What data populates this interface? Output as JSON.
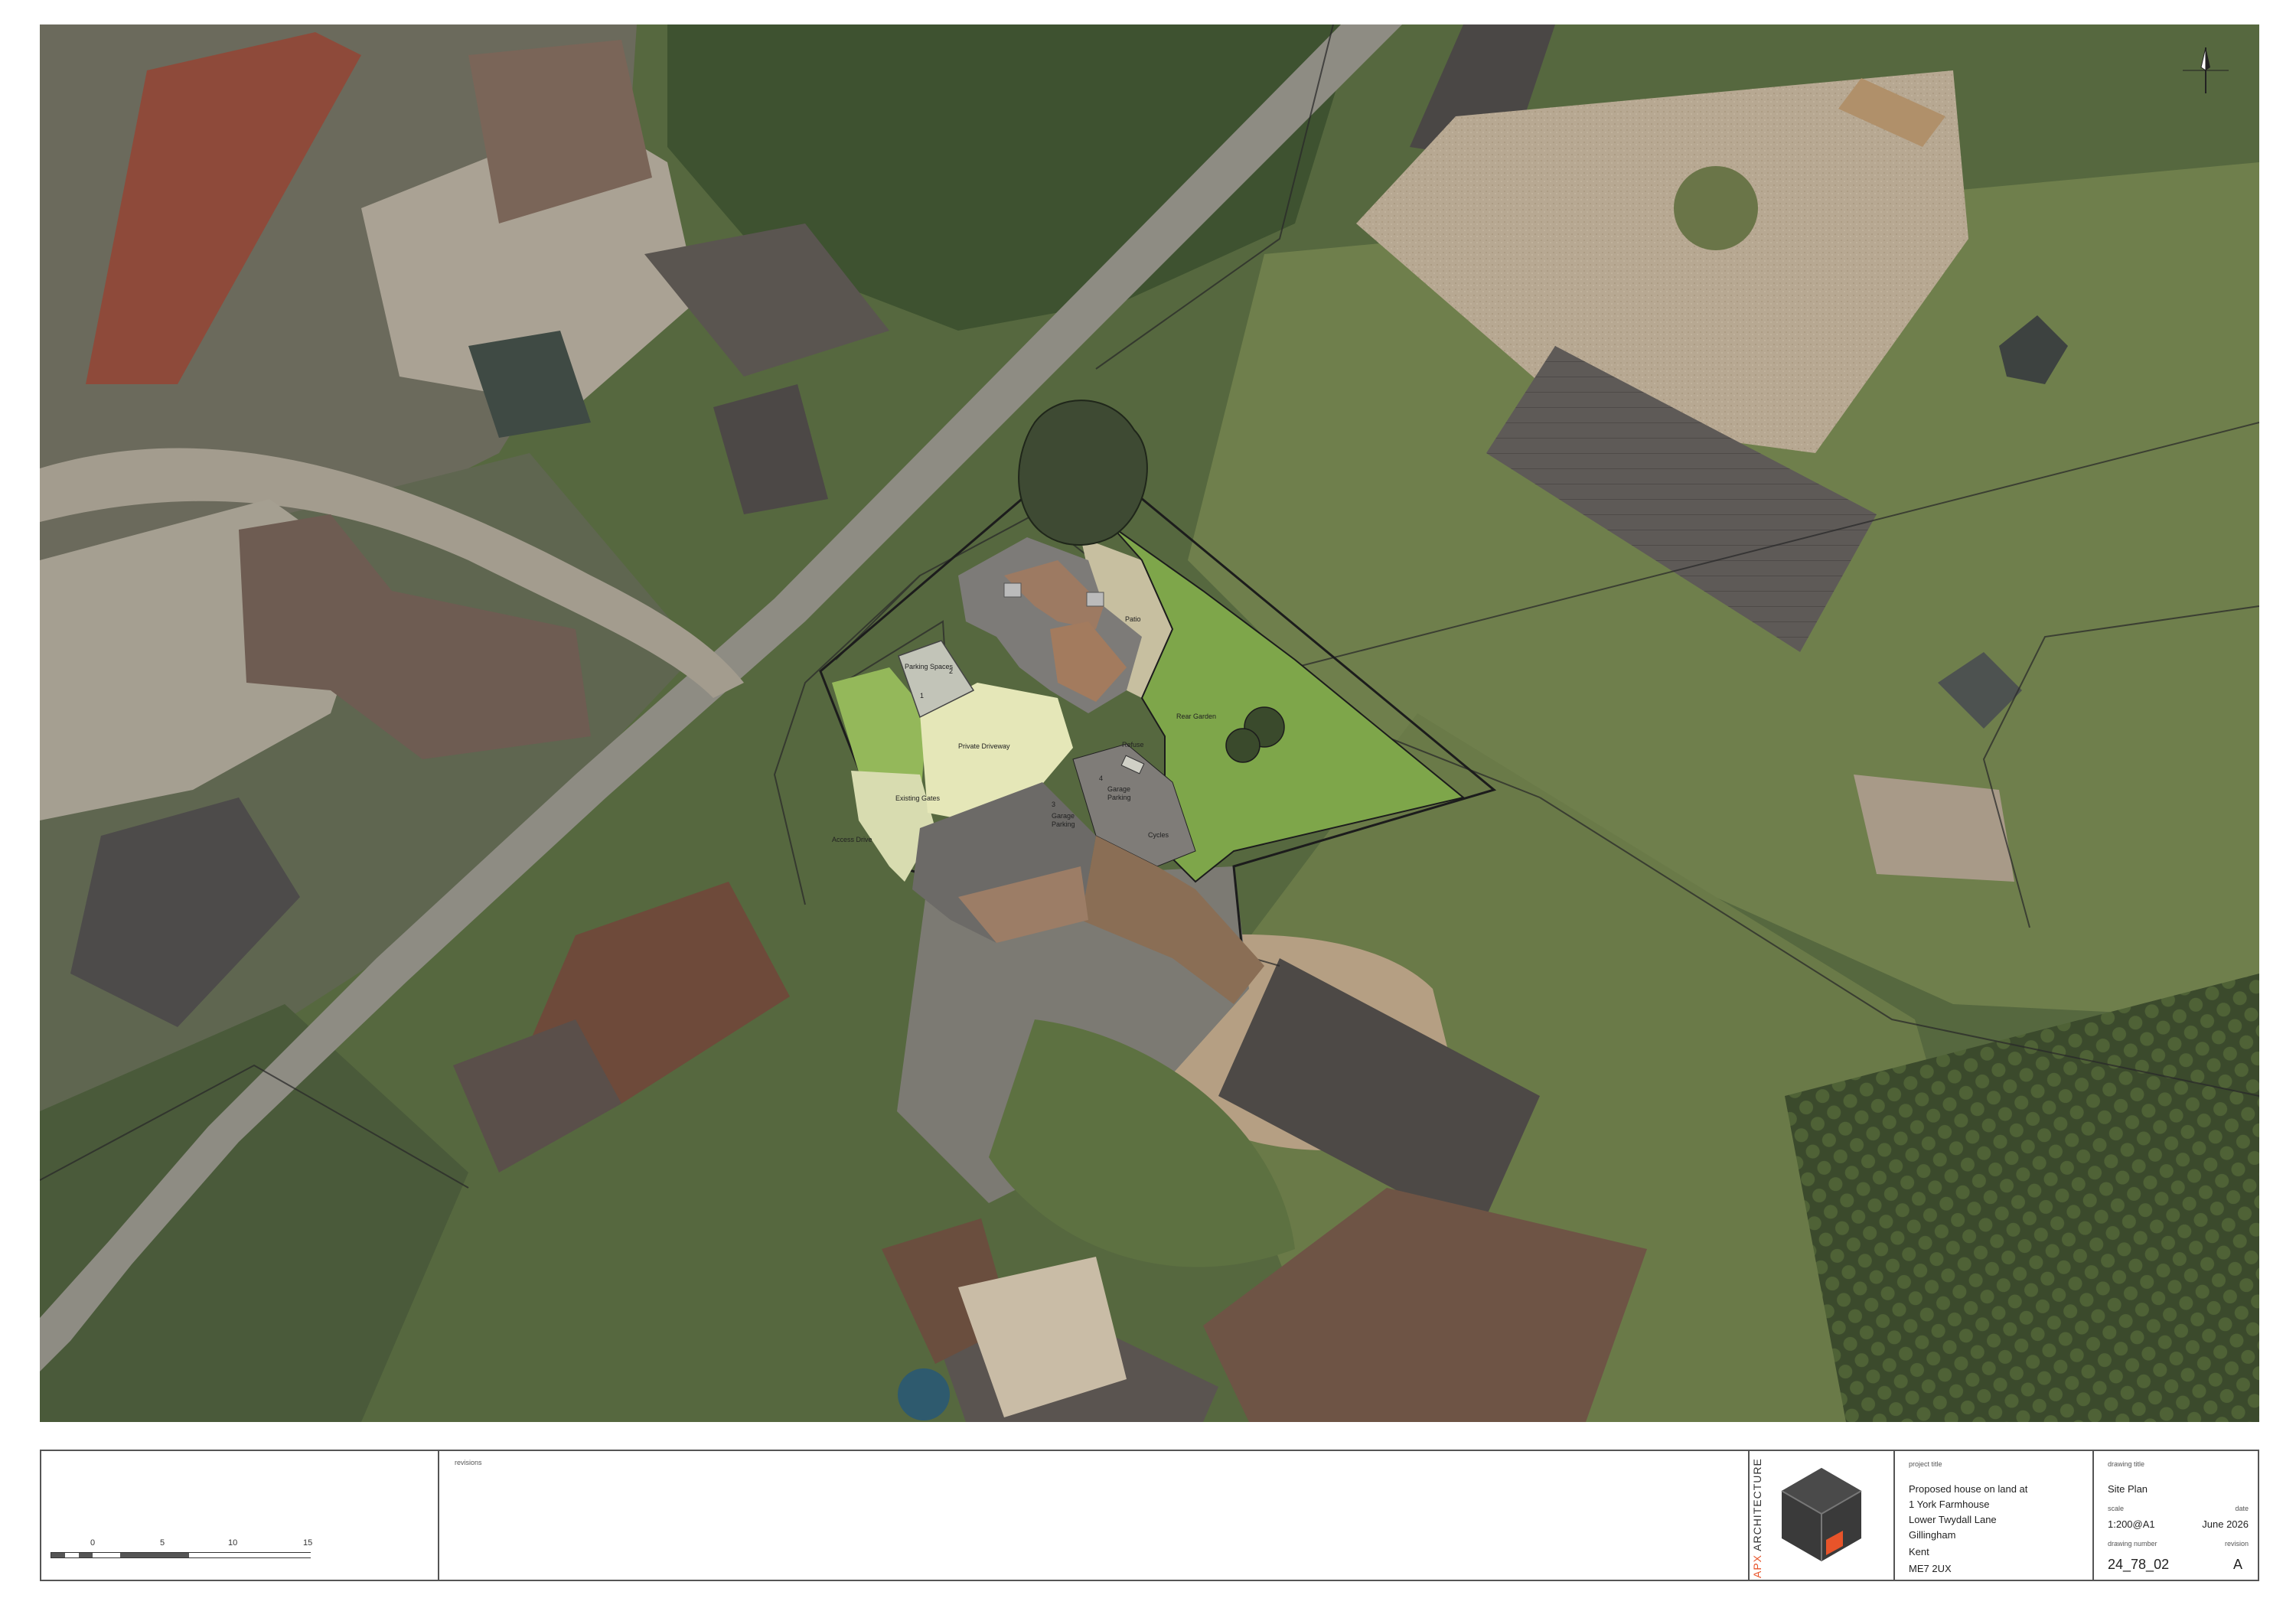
{
  "drawing_labels": {
    "parking_spaces": "Parking Spaces",
    "space_1": "1",
    "space_2": "2",
    "private_driveway": "Private Driveway",
    "existing_gates": "Existing Gates",
    "access_drive": "Access Drive",
    "patio": "Patio",
    "rear_garden": "Rear Garden",
    "refuse": "Refuse",
    "garage_parking_a": "Garage\nParking",
    "garage_parking_b": "Garage\nParking",
    "garage_space_3": "3",
    "garage_space_4": "4",
    "cycles": "Cycles"
  },
  "scale_bar": {
    "ticks": [
      "0",
      "5",
      "10",
      "15"
    ]
  },
  "revisions": {
    "label": "revisions"
  },
  "brand": {
    "name_a": "APX",
    "name_b": " ARCHITECTURE",
    "accent": "#e8542a"
  },
  "project": {
    "label": "project title",
    "line1": "Proposed house on land at",
    "line2": "1 York Farmhouse",
    "line3": "Lower Twydall Lane",
    "line4": "Gillingham",
    "line5": "Kent",
    "line6": "ME7 2UX"
  },
  "drawing": {
    "title_label": "drawing title",
    "title": "Site Plan",
    "scale_label": "scale",
    "scale": "1:200@A1",
    "date_label": "date",
    "date": "June 2026",
    "number_label": "drawing number",
    "number": "24_78_02",
    "revision_label": "revision",
    "revision": "A"
  },
  "north_arrow": {
    "icon": "north-arrow-icon"
  }
}
